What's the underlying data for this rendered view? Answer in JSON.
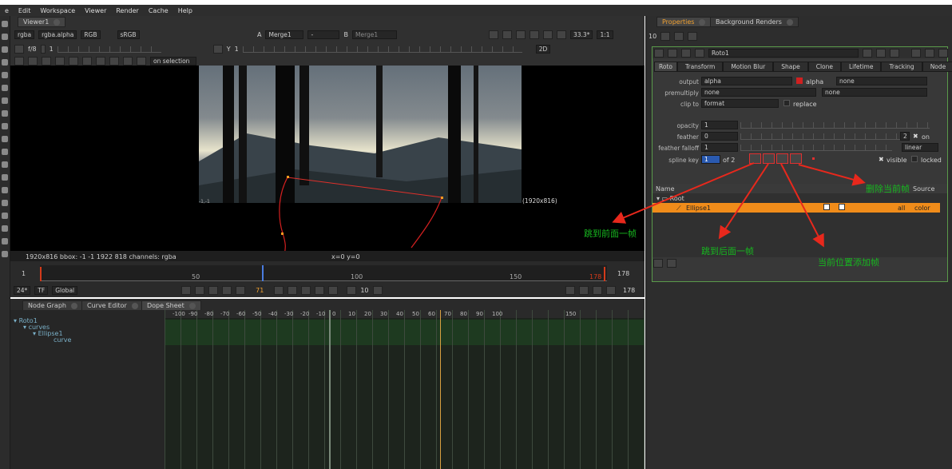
{
  "menubar": {
    "items": [
      "e",
      "Edit",
      "Workspace",
      "Viewer",
      "Render",
      "Cache",
      "Help"
    ]
  },
  "viewer": {
    "tab_label": "Viewer1",
    "channels": "rgba",
    "channel_alpha": "rgba.alpha",
    "display": "RGB",
    "colorspace": "sRGB",
    "input_a_label": "A",
    "input_a": "Merge1",
    "input_dash": "-",
    "input_b_label": "B",
    "input_b": "Merge1",
    "fstop": "f/8",
    "fstop_val": "1",
    "y_label": "Y",
    "y_val": "1",
    "zoom": "33.3*",
    "ratio": "1:1",
    "view_mode": "2D",
    "on_selection": "on selection",
    "format_label": "(1920x816)",
    "corner_label": "-1,-1",
    "info_text": "1920x816  bbox: -1 -1 1922 818 channels: rgba",
    "coords_text": "x=0 y=0"
  },
  "timeline": {
    "start": "1",
    "end_field": "178",
    "ticks": [
      "50",
      "100",
      "150"
    ],
    "end_marker": "178",
    "fps": "24*",
    "tf": "TF",
    "scope": "Global",
    "current_frame": "71",
    "step": "10",
    "end_frame": "178"
  },
  "bottom_tabs": [
    "Node Graph",
    "Curve Editor",
    "Dope Sheet"
  ],
  "dope_sheet": {
    "tree": [
      {
        "label": "Roto1",
        "indent": 0
      },
      {
        "label": "curves",
        "indent": 1
      },
      {
        "label": "Ellipse1",
        "indent": 2
      },
      {
        "label": "curve",
        "indent": 3
      }
    ],
    "ruler": [
      "-100",
      "-90",
      "-80",
      "-70",
      "-60",
      "-50",
      "-40",
      "-30",
      "-20",
      "-10",
      "0",
      "10",
      "20",
      "30",
      "40",
      "50",
      "60",
      "70",
      "80",
      "90",
      "100",
      "150"
    ]
  },
  "right_tabs": {
    "properties": "Properties",
    "background": "Background Renders"
  },
  "props": {
    "count": "10",
    "node_name": "Roto1",
    "tabs": [
      "Roto",
      "Transform",
      "Motion Blur",
      "Shape",
      "Clone",
      "Lifetime",
      "Tracking",
      "Node"
    ],
    "output_label": "output",
    "output_value": "alpha",
    "alpha_label": "alpha",
    "output_none": "none",
    "premultiply_label": "premultiply",
    "premultiply_value": "none",
    "premultiply_none": "none",
    "clipto_label": "clip to",
    "clipto_value": "format",
    "replace_label": "replace",
    "opacity_label": "opacity",
    "opacity_value": "1",
    "feather_label": "feather",
    "feather_value": "0",
    "feather_count": "2",
    "feather_on": "on",
    "falloff_label": "feather falloff",
    "falloff_value": "1",
    "falloff_mode": "linear",
    "splinekey_label": "spline key",
    "splinekey_value": "1",
    "splinekey_of": "of 2",
    "visible_label": "visible",
    "locked_label": "locked",
    "opacity_ticks": [
      "0",
      "0.01",
      "0.03",
      "0.05",
      "0.1",
      "0.2",
      "0.3",
      "0.4",
      "0.5",
      "1"
    ],
    "feather_ticks": [
      "-100",
      "-75",
      "-50",
      "-25",
      "0",
      "25",
      "50",
      "75",
      "100"
    ],
    "falloff_ticks": [
      "1",
      "2",
      "3",
      "4",
      "5",
      "6"
    ]
  },
  "layers": {
    "header_name": "Name",
    "header_source": "Source",
    "root_label": "Root",
    "ellipse_label": "Ellipse1",
    "ellipse_all": "all",
    "ellipse_color": "color"
  },
  "annotations": {
    "delete_key": "删除当前帧",
    "prev_key": "跳到前面一帧",
    "next_key": "跳到后面一帧",
    "add_key": "当前位置添加帧",
    "color": "#17b61f",
    "arrow_color": "#e8281c"
  }
}
